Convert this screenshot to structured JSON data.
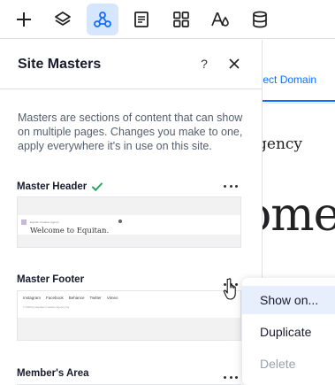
{
  "toolbar": {
    "tools": [
      {
        "icon": "plus-icon"
      },
      {
        "icon": "layers-icon"
      },
      {
        "icon": "site-masters-icon",
        "active": true
      },
      {
        "icon": "pages-icon"
      },
      {
        "icon": "apps-icon"
      },
      {
        "icon": "theme-icon"
      },
      {
        "icon": "database-icon"
      }
    ],
    "active_color": "#d6e6fe"
  },
  "canvas": {
    "connect_link": "nnect Domain",
    "subheading": "gency",
    "big_text": "ome"
  },
  "panel": {
    "title": "Site Masters",
    "help_label": "?",
    "description": "Masters are sections of content that can show on multiple pages. Changes you make to one, apply everywhere it's in use on this site.",
    "masters": [
      {
        "title": "Master Header",
        "active": true,
        "preview": {
          "tiny_text": "Equitan Creative Agency",
          "welcome": "Welcome to Equitan."
        }
      },
      {
        "title": "Master Footer",
        "active": false,
        "preview": {
          "links": [
            "Instagram",
            "Facebook",
            "Behance",
            "Twitter",
            "Vimeo"
          ],
          "copyright": "© 2023 by Equitan Creative Agency Inc."
        }
      },
      {
        "title": "Member's Area",
        "active": false
      }
    ]
  },
  "context_menu": {
    "items": [
      {
        "label": "Show on...",
        "state": "hover"
      },
      {
        "label": "Duplicate",
        "state": "normal"
      },
      {
        "label": "Delete",
        "state": "disabled"
      }
    ]
  },
  "colors": {
    "accent": "#116dff",
    "check": "#25a55f"
  }
}
